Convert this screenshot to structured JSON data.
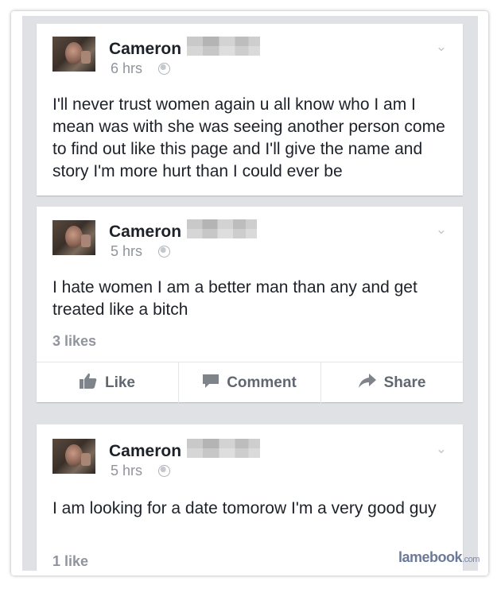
{
  "posts": [
    {
      "author": "Cameron",
      "time": "6 hrs",
      "text": "I'll never trust women again u all know who I am I mean was with she was seeing another person come to find out  like this page and I'll give the name and story I'm more hurt than I could ever be"
    },
    {
      "author": "Cameron",
      "time": "5 hrs",
      "text": "I hate women I am a better man than any and get treated like a bitch",
      "likes": "3 likes"
    },
    {
      "author": "Cameron",
      "time": "5 hrs",
      "text": "I am looking for a date tomorow I'm a very good guy",
      "likes": "1 like"
    }
  ],
  "actions": {
    "like": "Like",
    "comment": "Comment",
    "share": "Share"
  },
  "icons": {
    "chevron": "chevron-down-icon",
    "privacy": "globe-icon",
    "like": "thumbs-up-icon",
    "comment": "speech-bubble-icon",
    "share": "share-arrow-icon"
  },
  "watermark": {
    "brand": "lamebook",
    "tld": ".com"
  },
  "colors": {
    "feed_background": "#dfe1e5",
    "author_text": "#1d2129",
    "meta_text": "#90949c",
    "action_text": "#616770",
    "watermark": "#6b7a99"
  }
}
